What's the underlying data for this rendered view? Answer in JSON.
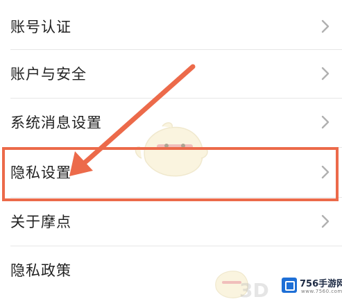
{
  "menu": {
    "items": [
      {
        "label": "账号认证",
        "has_chevron": true
      },
      {
        "label": "账户与安全",
        "has_chevron": true
      },
      {
        "label": "系统消息设置",
        "has_chevron": true
      },
      {
        "label": "隐私设置",
        "has_chevron": true,
        "highlighted": true
      },
      {
        "label": "关于摩点",
        "has_chevron": true
      },
      {
        "label": "隐私政策",
        "has_chevron": false
      }
    ]
  },
  "annotation": {
    "color": "#ec6a4a",
    "target": "隐私设置"
  },
  "watermark": {
    "brand": "756手游网",
    "url": "www.7560.com",
    "faint_text": "3D"
  },
  "colors": {
    "text": "#222222",
    "chevron": "#b0b0b0",
    "divider": "#e6e6e6",
    "brand_blue": "#1e6fd6"
  }
}
